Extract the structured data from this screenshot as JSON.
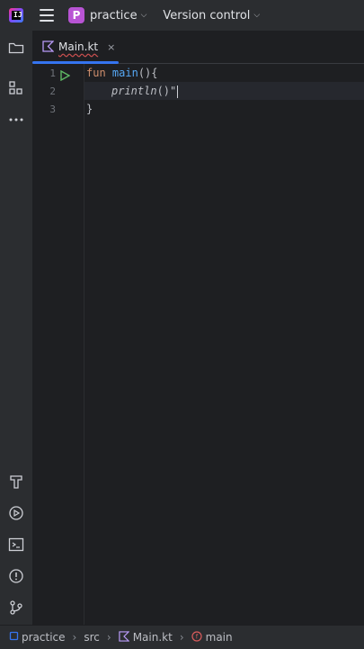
{
  "titlebar": {
    "project_initial": "P",
    "project_name": "practice",
    "vcs_label": "Version control"
  },
  "tabs": [
    {
      "label": "Main.kt",
      "close": "×"
    }
  ],
  "editor": {
    "line_numbers": [
      "1",
      "2",
      "3"
    ],
    "lines": [
      {
        "kw": "fun ",
        "fn": "main",
        "rest": "(){"
      },
      {
        "call": "println",
        "rest": "()\""
      },
      {
        "rest": "}"
      }
    ]
  },
  "breadcrumbs": {
    "project": "practice",
    "folder": "src",
    "file": "Main.kt",
    "symbol": "main"
  },
  "colors": {
    "accent": "#3574f0",
    "project_badge": "#b854d4",
    "keyword": "#cf8e6d",
    "function": "#56a8f5",
    "run": "#5fb865"
  }
}
